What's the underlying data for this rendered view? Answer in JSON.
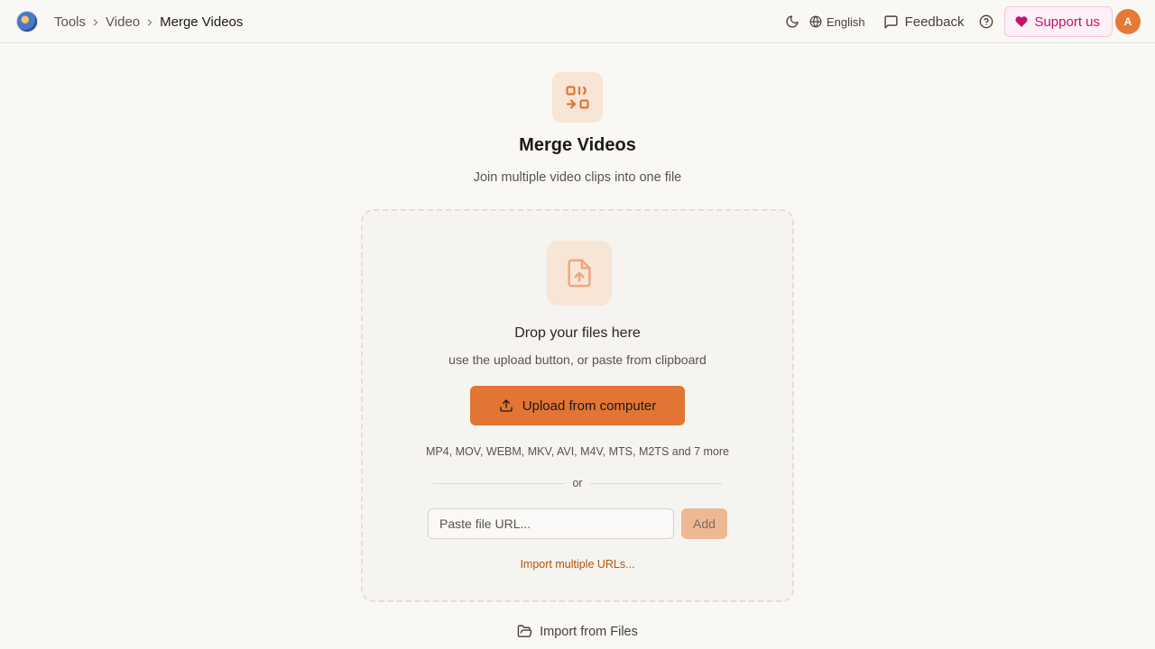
{
  "header": {
    "breadcrumbs": [
      {
        "label": "Tools"
      },
      {
        "label": "Video"
      },
      {
        "label": "Merge Videos"
      }
    ],
    "language": "English",
    "feedback": "Feedback",
    "support": "Support us",
    "avatar_initial": "A",
    "icons": [
      "app-logo-icon",
      "moon-icon",
      "globe-icon",
      "message-square-icon",
      "help-circle-icon",
      "heart-icon"
    ]
  },
  "hero": {
    "title": "Merge Videos",
    "subtitle": "Join multiple video clips into one file",
    "icon": "merge-icon"
  },
  "dropzone": {
    "title": "Drop your files here",
    "subtitle": "use the upload button, or paste from clipboard",
    "upload_label": "Upload from computer",
    "formats": "MP4, MOV, WEBM, MKV, AVI, M4V, MTS, M2TS and 7 more",
    "or": "or",
    "url_placeholder": "Paste file URL...",
    "add_label": "Add",
    "import_multiple": "Import multiple URLs..."
  },
  "import_files": "Import from Files",
  "colors": {
    "accent": "#e27533",
    "support": "#c0146a",
    "background": "#f9f8f5"
  }
}
